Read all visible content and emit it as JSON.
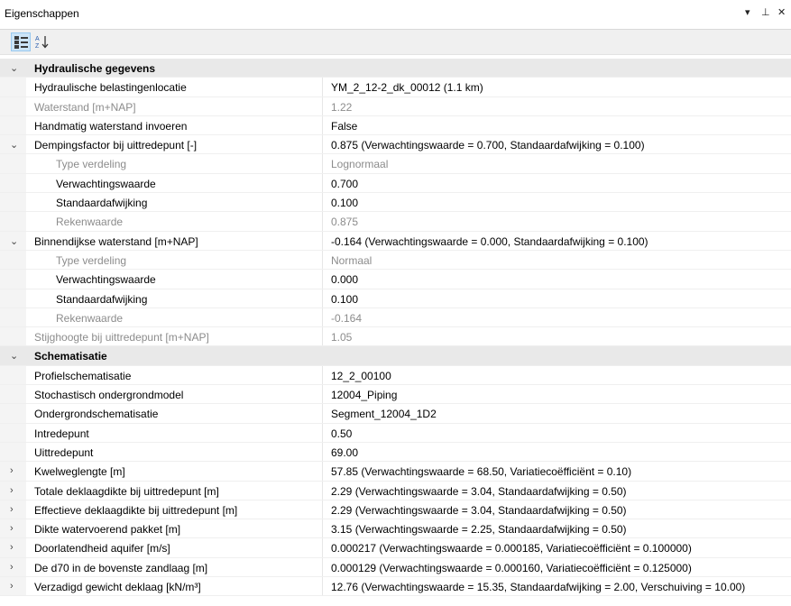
{
  "window": {
    "title": "Eigenschappen",
    "menu_glyph": "▾",
    "pin_glyph": "⊥",
    "close_glyph": "✕"
  },
  "toolbar": {
    "categorized_icon": "categorized-icon",
    "alphabetical_icon": "sort-alphabetical-icon"
  },
  "rows": [
    {
      "type": "category",
      "expand": "⌄",
      "name": "Hydraulische gegevens",
      "value": ""
    },
    {
      "type": "prop",
      "level": 1,
      "expand": "",
      "name": "Hydraulische belastingenlocatie",
      "value": "YM_2_12-2_dk_00012 (1.1 km)",
      "readonly": false
    },
    {
      "type": "prop",
      "level": 1,
      "expand": "",
      "name": "Waterstand [m+NAP]",
      "value": "1.22",
      "readonly": true
    },
    {
      "type": "prop",
      "level": 1,
      "expand": "",
      "name": "Handmatig waterstand invoeren",
      "value": "False",
      "readonly": false
    },
    {
      "type": "prop",
      "level": 1,
      "expand": "⌄",
      "name": "Dempingsfactor bij uittredepunt [-]",
      "value": "0.875 (Verwachtingswaarde = 0.700, Standaardafwijking = 0.100)",
      "readonly": false
    },
    {
      "type": "prop",
      "level": 2,
      "expand": "",
      "name": "Type verdeling",
      "value": "Lognormaal",
      "readonly": true
    },
    {
      "type": "prop",
      "level": 2,
      "expand": "",
      "name": "Verwachtingswaarde",
      "value": "0.700",
      "readonly": false
    },
    {
      "type": "prop",
      "level": 2,
      "expand": "",
      "name": "Standaardafwijking",
      "value": "0.100",
      "readonly": false
    },
    {
      "type": "prop",
      "level": 2,
      "expand": "",
      "name": "Rekenwaarde",
      "value": "0.875",
      "readonly": true
    },
    {
      "type": "prop",
      "level": 1,
      "expand": "⌄",
      "name": "Binnendijkse waterstand [m+NAP]",
      "value": "-0.164 (Verwachtingswaarde = 0.000, Standaardafwijking = 0.100)",
      "readonly": false
    },
    {
      "type": "prop",
      "level": 2,
      "expand": "",
      "name": "Type verdeling",
      "value": "Normaal",
      "readonly": true
    },
    {
      "type": "prop",
      "level": 2,
      "expand": "",
      "name": "Verwachtingswaarde",
      "value": "0.000",
      "readonly": false
    },
    {
      "type": "prop",
      "level": 2,
      "expand": "",
      "name": "Standaardafwijking",
      "value": "0.100",
      "readonly": false
    },
    {
      "type": "prop",
      "level": 2,
      "expand": "",
      "name": "Rekenwaarde",
      "value": "-0.164",
      "readonly": true
    },
    {
      "type": "prop",
      "level": 1,
      "expand": "",
      "name": "Stijghoogte bij uittredepunt [m+NAP]",
      "value": "1.05",
      "readonly": true
    },
    {
      "type": "category",
      "expand": "⌄",
      "name": "Schematisatie",
      "value": ""
    },
    {
      "type": "prop",
      "level": 1,
      "expand": "",
      "name": "Profielschematisatie",
      "value": "12_2_00100",
      "readonly": false
    },
    {
      "type": "prop",
      "level": 1,
      "expand": "",
      "name": "Stochastisch ondergrondmodel",
      "value": "12004_Piping",
      "readonly": false
    },
    {
      "type": "prop",
      "level": 1,
      "expand": "",
      "name": "Ondergrondschematisatie",
      "value": "Segment_12004_1D2",
      "readonly": false
    },
    {
      "type": "prop",
      "level": 1,
      "expand": "",
      "name": "Intredepunt",
      "value": "0.50",
      "readonly": false
    },
    {
      "type": "prop",
      "level": 1,
      "expand": "",
      "name": "Uittredepunt",
      "value": "69.00",
      "readonly": false
    },
    {
      "type": "prop",
      "level": 1,
      "expand": "›",
      "name": "Kwelweglengte [m]",
      "value": "57.85 (Verwachtingswaarde = 68.50, Variatiecoëfficiënt = 0.10)",
      "readonly": false
    },
    {
      "type": "prop",
      "level": 1,
      "expand": "›",
      "name": "Totale deklaagdikte bij uittredepunt [m]",
      "value": "2.29 (Verwachtingswaarde = 3.04, Standaardafwijking = 0.50)",
      "readonly": false
    },
    {
      "type": "prop",
      "level": 1,
      "expand": "›",
      "name": "Effectieve deklaagdikte bij uittredepunt [m]",
      "value": "2.29 (Verwachtingswaarde = 3.04, Standaardafwijking = 0.50)",
      "readonly": false
    },
    {
      "type": "prop",
      "level": 1,
      "expand": "›",
      "name": "Dikte watervoerend pakket [m]",
      "value": "3.15 (Verwachtingswaarde = 2.25, Standaardafwijking = 0.50)",
      "readonly": false
    },
    {
      "type": "prop",
      "level": 1,
      "expand": "›",
      "name": "Doorlatendheid aquifer [m/s]",
      "value": "0.000217 (Verwachtingswaarde = 0.000185, Variatiecoëfficiënt = 0.100000)",
      "readonly": false
    },
    {
      "type": "prop",
      "level": 1,
      "expand": "›",
      "name": "De d70 in de bovenste zandlaag [m]",
      "value": "0.000129 (Verwachtingswaarde = 0.000160, Variatiecoëfficiënt = 0.125000)",
      "readonly": false
    },
    {
      "type": "prop",
      "level": 1,
      "expand": "›",
      "name": "Verzadigd gewicht deklaag [kN/m³]",
      "value": "12.76 (Verwachtingswaarde = 15.35, Standaardafwijking = 2.00, Verschuiving = 10.00)",
      "readonly": false
    }
  ],
  "colors": {
    "category_bg": "#e9e9e9",
    "readonly_text": "#8c8c8c",
    "toolbar_bg": "#f0f0f0",
    "selected_btn": "#cce4f7"
  }
}
